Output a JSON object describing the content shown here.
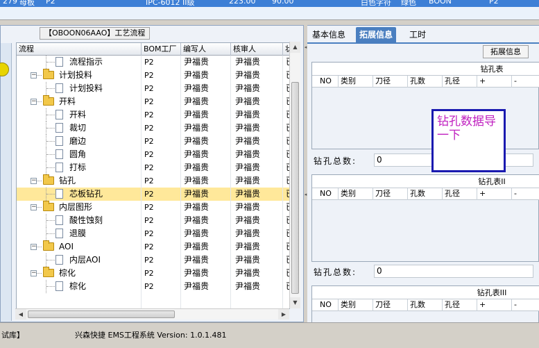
{
  "top_row": [
    "279",
    "母板",
    "P2",
    "IPC-6012 II级",
    "223.00",
    "90.00",
    "白色字符",
    "绿色",
    "BOON",
    "P2"
  ],
  "left": {
    "process_title": "【OBOON06AAO】工艺流程",
    "columns": [
      "流程",
      "BOM工厂",
      "编写人",
      "核审人",
      "状态"
    ],
    "rows": [
      {
        "name": "流程指示",
        "level": 1,
        "kind": "doc",
        "factory": "P2",
        "writer": "尹福贵",
        "reviewer": "尹福贵",
        "status": "已审"
      },
      {
        "name": "计划投料",
        "level": 0,
        "kind": "folder",
        "factory": "P2",
        "writer": "尹福贵",
        "reviewer": "尹福贵",
        "status": "已审"
      },
      {
        "name": "计划投料",
        "level": 1,
        "kind": "doc",
        "factory": "P2",
        "writer": "尹福贵",
        "reviewer": "尹福贵",
        "status": "已审"
      },
      {
        "name": "开料",
        "level": 0,
        "kind": "folder",
        "factory": "P2",
        "writer": "尹福贵",
        "reviewer": "尹福贵",
        "status": "已审"
      },
      {
        "name": "开料",
        "level": 1,
        "kind": "doc",
        "factory": "P2",
        "writer": "尹福贵",
        "reviewer": "尹福贵",
        "status": "已审"
      },
      {
        "name": "裁切",
        "level": 1,
        "kind": "doc",
        "factory": "P2",
        "writer": "尹福贵",
        "reviewer": "尹福贵",
        "status": "已审"
      },
      {
        "name": "磨边",
        "level": 1,
        "kind": "doc",
        "factory": "P2",
        "writer": "尹福贵",
        "reviewer": "尹福贵",
        "status": "已审"
      },
      {
        "name": "圆角",
        "level": 1,
        "kind": "doc",
        "factory": "P2",
        "writer": "尹福贵",
        "reviewer": "尹福贵",
        "status": "已审"
      },
      {
        "name": "打标",
        "level": 1,
        "kind": "doc",
        "factory": "P2",
        "writer": "尹福贵",
        "reviewer": "尹福贵",
        "status": "已审"
      },
      {
        "name": "钻孔",
        "level": 0,
        "kind": "folder",
        "factory": "P2",
        "writer": "尹福贵",
        "reviewer": "尹福贵",
        "status": "已审"
      },
      {
        "name": "芯板钻孔",
        "level": 1,
        "kind": "doc",
        "factory": "P2",
        "writer": "尹福贵",
        "reviewer": "尹福贵",
        "status": "已审",
        "selected": true
      },
      {
        "name": "内层图形",
        "level": 0,
        "kind": "folder",
        "factory": "P2",
        "writer": "尹福贵",
        "reviewer": "尹福贵",
        "status": "已审"
      },
      {
        "name": "酸性蚀刻",
        "level": 1,
        "kind": "doc",
        "factory": "P2",
        "writer": "尹福贵",
        "reviewer": "尹福贵",
        "status": "已审"
      },
      {
        "name": "退膜",
        "level": 1,
        "kind": "doc",
        "factory": "P2",
        "writer": "尹福贵",
        "reviewer": "尹福贵",
        "status": "已审"
      },
      {
        "name": "AOI",
        "level": 0,
        "kind": "folder",
        "factory": "P2",
        "writer": "尹福贵",
        "reviewer": "尹福贵",
        "status": "已审"
      },
      {
        "name": "内层AOI",
        "level": 1,
        "kind": "doc",
        "factory": "P2",
        "writer": "尹福贵",
        "reviewer": "尹福贵",
        "status": "已审"
      },
      {
        "name": "棕化",
        "level": 0,
        "kind": "folder",
        "factory": "P2",
        "writer": "尹福贵",
        "reviewer": "尹福贵",
        "status": "已审"
      },
      {
        "name": "棕化",
        "level": 1,
        "kind": "doc",
        "factory": "P2",
        "writer": "尹福贵",
        "reviewer": "尹福贵",
        "status": "已审"
      }
    ]
  },
  "right": {
    "tabs": [
      {
        "label": "基本信息",
        "active": false
      },
      {
        "label": "拓展信息",
        "active": true
      },
      {
        "label": "工时",
        "active": false
      }
    ],
    "ext_title": "拓展信息",
    "drill_columns": [
      "NO",
      "类别",
      "刀径",
      "孔数",
      "孔径",
      "+",
      "-"
    ],
    "drill_tables": [
      {
        "title": "钻孔表",
        "total_label": "钻孔总数:",
        "total_value": "0"
      },
      {
        "title": "钻孔表II",
        "total_label": "钻孔总数:",
        "total_value": "0"
      },
      {
        "title": "钻孔表III"
      }
    ],
    "callout": "钻孔数据导一下"
  },
  "status": {
    "left_text": "试库】",
    "app_text": "兴森快捷 EMS工程系统 Version: 1.0.1.481"
  },
  "colors": {
    "selection": "#ffe89a",
    "tab_active": "#4a7fc0",
    "callout_border": "#1a1ab0",
    "callout_text": "#c020c0",
    "top_row": "#3d7fd6"
  }
}
